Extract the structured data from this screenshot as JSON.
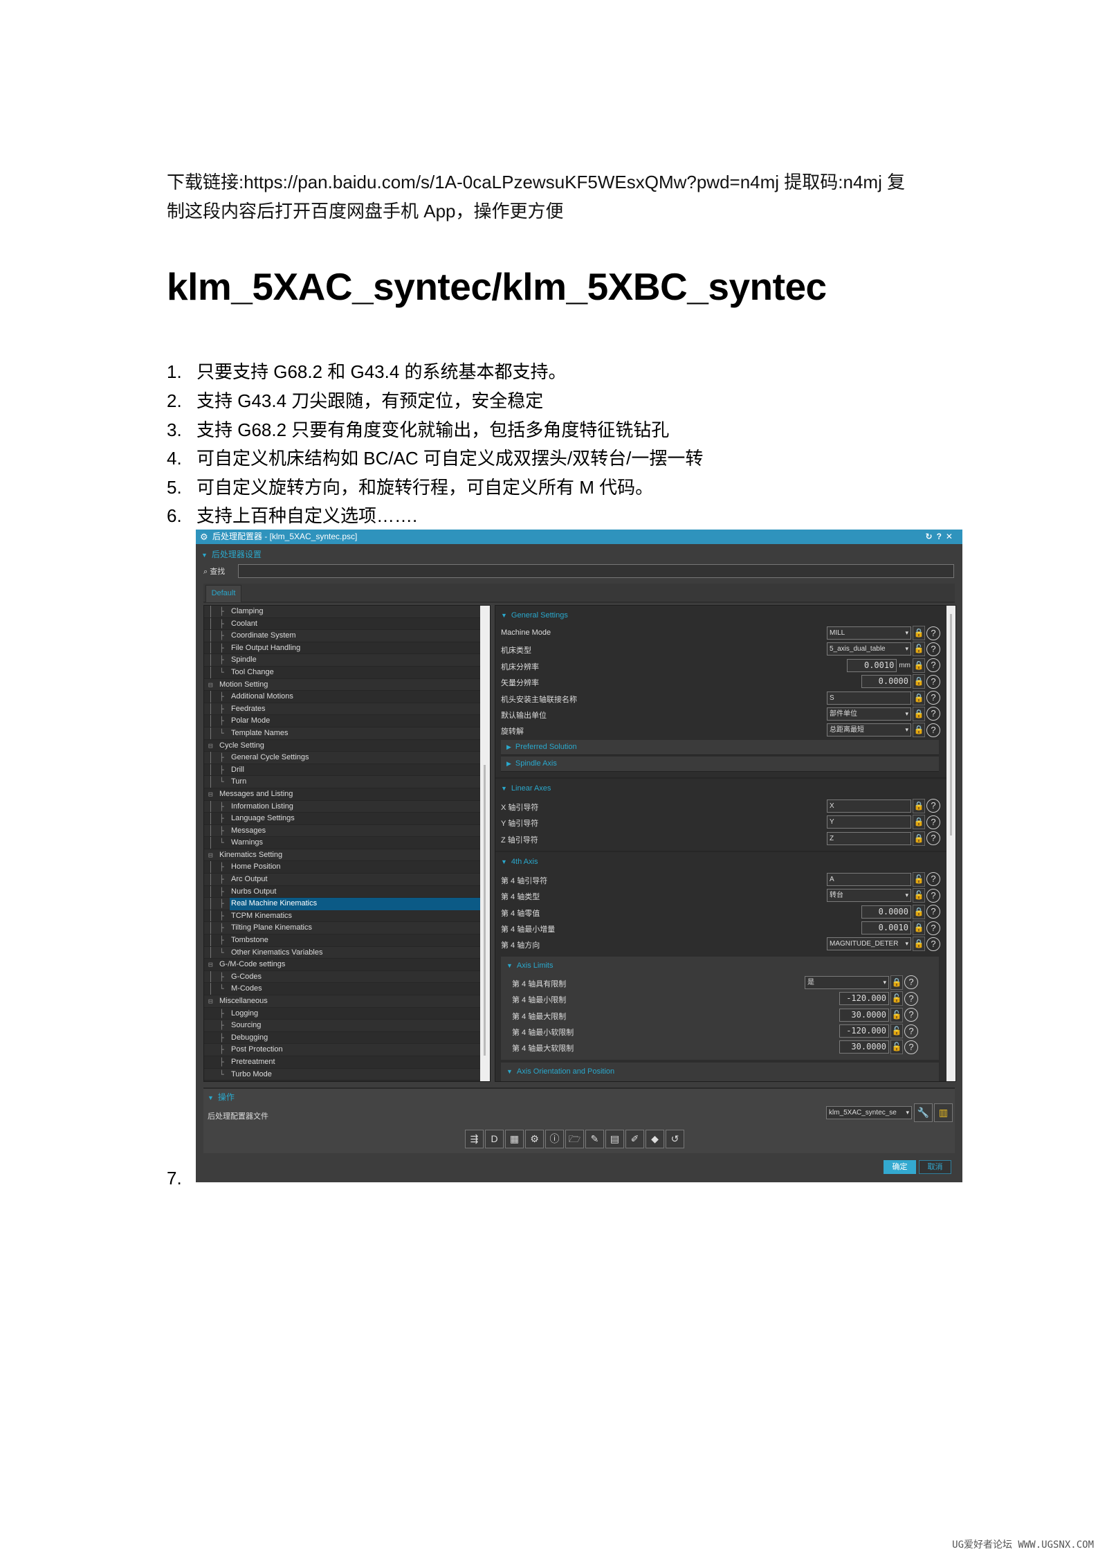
{
  "doc": {
    "line1": "下载链接:https://pan.baidu.com/s/1A-0caLPzewsuKF5WEsxQMw?pwd=n4mj  提取码:n4mj  复",
    "line2": "制这段内容后打开百度网盘手机 App，操作更方便",
    "title": "klm_5XAC_syntec/klm_5XBC_syntec",
    "list": [
      {
        "n": "1.",
        "text": "只要支持 G68.2 和 G43.4 的系统基本都支持。"
      },
      {
        "n": "2.",
        "text": "支持 G43.4 刀尖跟随，有预定位，安全稳定"
      },
      {
        "n": "3.",
        "text": "支持 G68.2 只要有角度变化就输出，包括多角度特征铣钻孔"
      },
      {
        "n": "4.",
        "text": "可自定义机床结构如 BC/AC  可自定义成双摆头/双转台/一摆一转"
      },
      {
        "n": "5.",
        "text": "可自定义旋转方向，和旋转行程，可自定义所有 M 代码。"
      },
      {
        "n": "6.",
        "text": "支持上百种自定义选项……."
      }
    ],
    "item7": "7.",
    "watermark": "UG爱好者论坛 WWW.UGSNX.COM"
  },
  "ui": {
    "title": "后处理配置器 - [klm_5XAC_syntec.psc]",
    "title_controls": "↻?✕",
    "settings_header": "后处理器设置",
    "search_label": "查找",
    "search_value": "",
    "tab_default": "Default",
    "tree": [
      {
        "label": "Clamping",
        "level": 1
      },
      {
        "label": "Coolant",
        "level": 1
      },
      {
        "label": "Coordinate System",
        "level": 1
      },
      {
        "label": "File Output Handling",
        "level": 1
      },
      {
        "label": "Spindle",
        "level": 1
      },
      {
        "label": "Tool Change",
        "level": 1,
        "last": true
      },
      {
        "label": "Motion Setting",
        "level": 0
      },
      {
        "label": "Additional Motions",
        "level": 1
      },
      {
        "label": "Feedrates",
        "level": 1
      },
      {
        "label": "Polar Mode",
        "level": 1
      },
      {
        "label": "Template Names",
        "level": 1,
        "last": true
      },
      {
        "label": "Cycle Setting",
        "level": 0
      },
      {
        "label": "General Cycle Settings",
        "level": 1
      },
      {
        "label": "Drill",
        "level": 1
      },
      {
        "label": "Turn",
        "level": 1,
        "last": true
      },
      {
        "label": "Messages and Listing",
        "level": 0
      },
      {
        "label": "Information Listing",
        "level": 1
      },
      {
        "label": "Language Settings",
        "level": 1
      },
      {
        "label": "Messages",
        "level": 1
      },
      {
        "label": "Warnings",
        "level": 1,
        "last": true
      },
      {
        "label": "Kinematics Setting",
        "level": 0
      },
      {
        "label": "Home Position",
        "level": 1
      },
      {
        "label": "Arc Output",
        "level": 1
      },
      {
        "label": "Nurbs Output",
        "level": 1
      },
      {
        "label": "Real Machine Kinematics",
        "level": 1,
        "selected": true
      },
      {
        "label": "TCPM Kinematics",
        "level": 1
      },
      {
        "label": "Tilting Plane Kinematics",
        "level": 1
      },
      {
        "label": "Tombstone",
        "level": 1
      },
      {
        "label": "Other Kinematics Variables",
        "level": 1,
        "last": true
      },
      {
        "label": "G-/M-Code settings",
        "level": 0
      },
      {
        "label": "G-Codes",
        "level": 1
      },
      {
        "label": "M-Codes",
        "level": 1,
        "last": true
      },
      {
        "label": "Miscellaneous",
        "level": 0
      },
      {
        "label": "Logging",
        "level": 1
      },
      {
        "label": "Sourcing",
        "level": 1
      },
      {
        "label": "Debugging",
        "level": 1
      },
      {
        "label": "Post Protection",
        "level": 1
      },
      {
        "label": "Pretreatment",
        "level": 1
      },
      {
        "label": "Turbo Mode",
        "level": 1,
        "last": true
      }
    ],
    "general": {
      "header": "General Settings",
      "rows": [
        {
          "label": "Machine Mode",
          "type": "dd",
          "value": "MILL",
          "locked": true
        },
        {
          "label": "机床类型",
          "type": "dd",
          "value": "5_axis_dual_table",
          "locked": false
        },
        {
          "label": "机床分辨率",
          "type": "num",
          "value": "0.0010",
          "unit": "mm",
          "locked": true
        },
        {
          "label": "矢量分辨率",
          "type": "num",
          "value": "0.0000",
          "locked": true
        },
        {
          "label": "机头安装主轴联接名称",
          "type": "tx",
          "value": "S",
          "locked": true
        },
        {
          "label": "默认输出单位",
          "type": "dd",
          "value": "部件单位",
          "locked": true
        },
        {
          "label": "旋转解",
          "type": "dd",
          "value": "总距离最短",
          "locked": true
        }
      ],
      "bars": [
        "Preferred Solution",
        "Spindle Axis"
      ]
    },
    "linear": {
      "header": "Linear Axes",
      "rows": [
        {
          "label": "X 轴引导符",
          "type": "tx",
          "value": "X",
          "locked": true
        },
        {
          "label": "Y 轴引导符",
          "type": "tx",
          "value": "Y",
          "locked": true
        },
        {
          "label": "Z 轴引导符",
          "type": "tx",
          "value": "Z",
          "locked": true
        }
      ]
    },
    "fourth": {
      "header": "4th Axis",
      "rows": [
        {
          "label": "第 4 轴引导符",
          "type": "tx",
          "value": "A",
          "locked": false
        },
        {
          "label": "第 4 轴类型",
          "type": "dd",
          "value": "转台",
          "locked": false
        },
        {
          "label": "第 4 轴零值",
          "type": "num",
          "value": "0.0000",
          "locked": true
        },
        {
          "label": "第 4 轴最小增量",
          "type": "num",
          "value": "0.0010",
          "locked": true
        },
        {
          "label": "第 4 轴方向",
          "type": "dd",
          "value": "MAGNITUDE_DETER",
          "locked": true
        }
      ]
    },
    "limits": {
      "header": "Axis Limits",
      "rows": [
        {
          "label": "第 4 轴具有限制",
          "type": "dd",
          "value": "是",
          "locked": true
        },
        {
          "label": "第 4 轴最小限制",
          "type": "num",
          "value": "-120.000",
          "locked": false
        },
        {
          "label": "第 4 轴最大限制",
          "type": "num",
          "value": "30.0000",
          "locked": false
        },
        {
          "label": "第 4 轴最小软限制",
          "type": "num",
          "value": "-120.000",
          "locked": false
        },
        {
          "label": "第 4 轴最大软限制",
          "type": "num",
          "value": "30.0000",
          "locked": false
        }
      ]
    },
    "orientation_header": "Axis Orientation and Position",
    "ops_header": "操作",
    "file_label": "后处理配置器文件",
    "file_select": "klm_5XAC_syntec_se",
    "toolbar": [
      {
        "icon": "convert-icon",
        "glyph": "⇶"
      },
      {
        "icon": "def-file-icon",
        "glyph": "D"
      },
      {
        "icon": "edit-table-icon",
        "glyph": "▦"
      },
      {
        "icon": "settings-stack-icon",
        "glyph": "⚙"
      },
      {
        "icon": "info-icon",
        "glyph": "ⓘ"
      },
      {
        "icon": "folder-open-icon",
        "glyph": "🗁"
      },
      {
        "icon": "edit-window-icon",
        "glyph": "✎"
      },
      {
        "icon": "save-icon",
        "glyph": "▤"
      },
      {
        "icon": "save-as-icon",
        "glyph": "✐"
      },
      {
        "icon": "tag-icon",
        "glyph": "◆"
      },
      {
        "icon": "undo-icon",
        "glyph": "↺"
      }
    ],
    "ok": "确定",
    "cancel": "取消",
    "accent": "#2aa8cc"
  }
}
